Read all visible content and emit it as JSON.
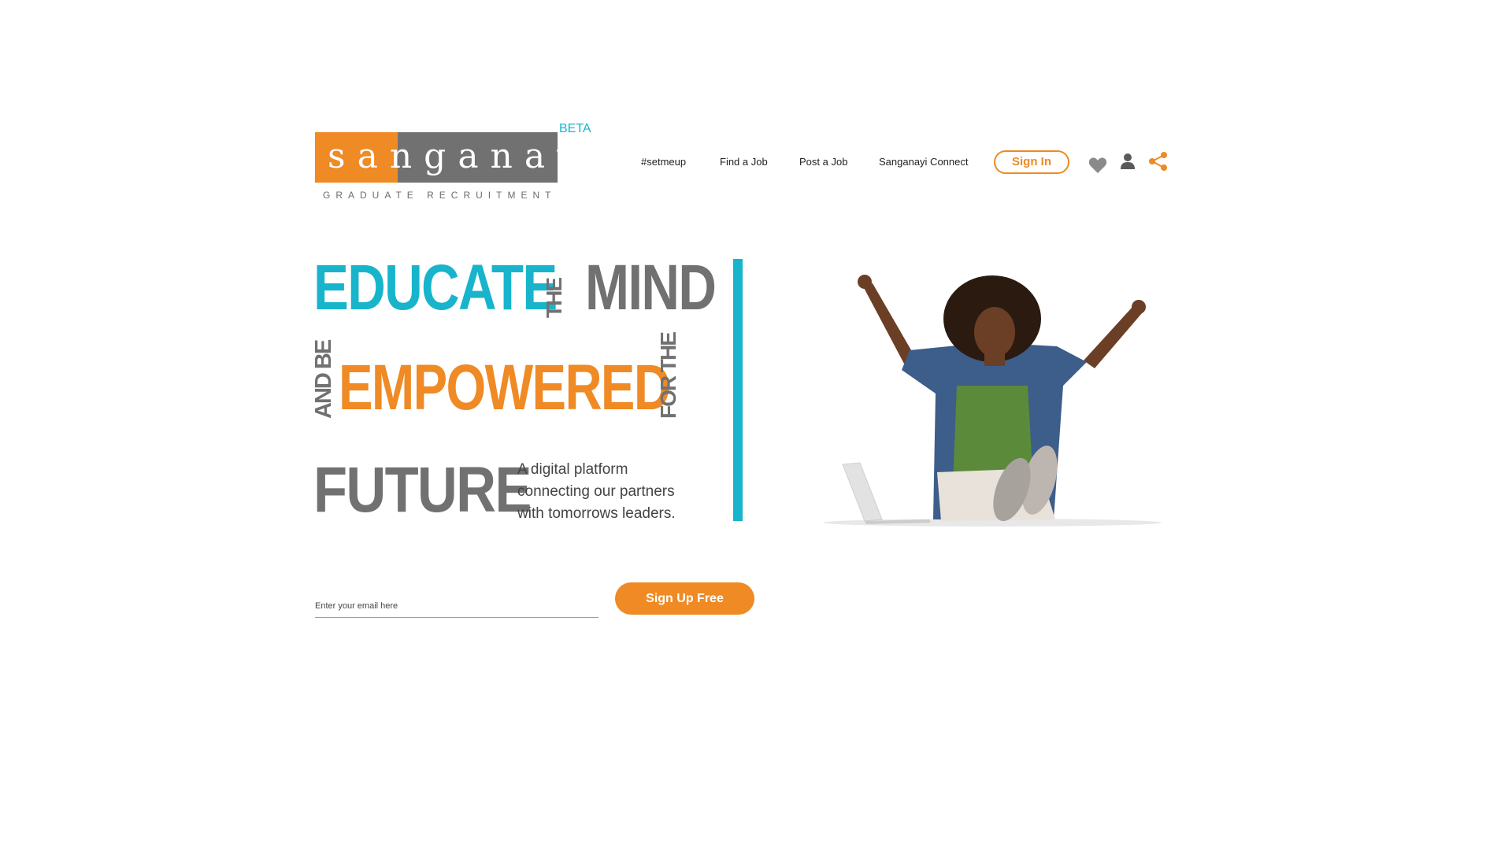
{
  "brand": {
    "logo_text": "sanganayi",
    "logo_subtitle": "GRADUATE RECRUITMENT",
    "beta_label": "BETA",
    "colors": {
      "orange": "#ef8a24",
      "teal": "#17b4cc",
      "gray": "#717171"
    }
  },
  "nav": {
    "items": [
      {
        "label": "#setmeup"
      },
      {
        "label": "Find a Job"
      },
      {
        "label": "Post a Job"
      },
      {
        "label": "Sanganayi Connect"
      }
    ],
    "sign_in_label": "Sign In",
    "icons": [
      "heart-icon",
      "user-icon",
      "share-icon"
    ]
  },
  "hero": {
    "word1": "EDUCATE",
    "word2": "THE",
    "word3": "MIND",
    "word4": "AND BE",
    "word5": "EMPOWERED",
    "word6": "FOR THE",
    "word7": "FUTURE",
    "tagline": [
      "A digital platform",
      "connecting our partners",
      "with tomorrows leaders."
    ]
  },
  "signup": {
    "email_placeholder": "Enter your email here",
    "email_value": "",
    "button_label": "Sign Up Free"
  }
}
